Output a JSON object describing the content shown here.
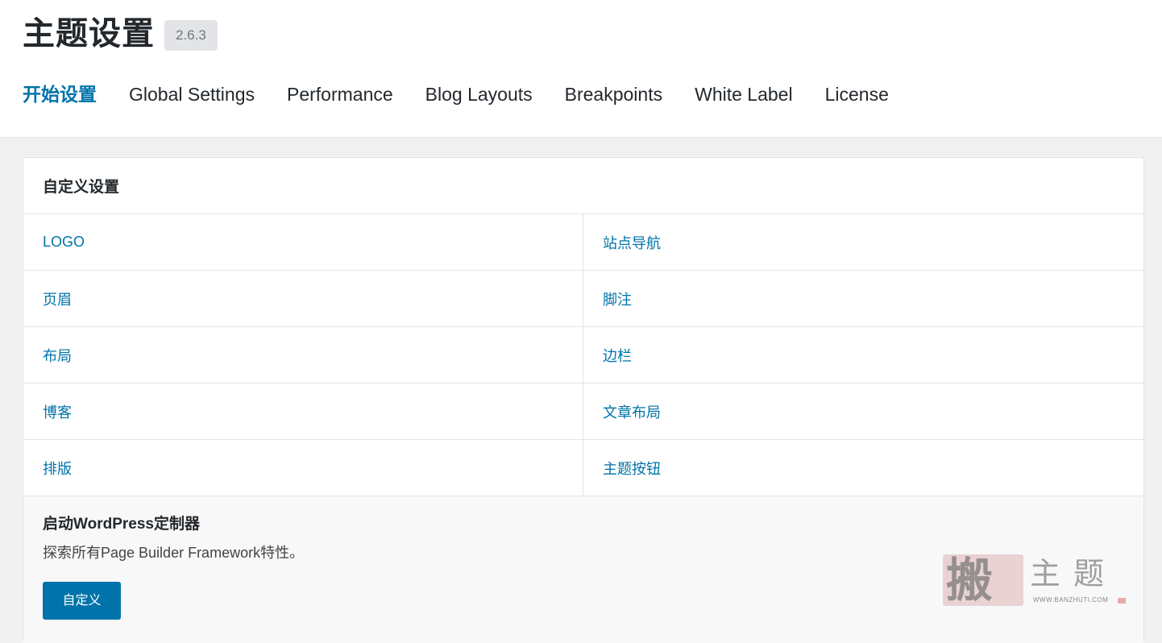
{
  "header": {
    "title": "主题设置",
    "version": "2.6.3"
  },
  "tabs": [
    {
      "label": "开始设置",
      "active": true
    },
    {
      "label": "Global Settings",
      "active": false
    },
    {
      "label": "Performance",
      "active": false
    },
    {
      "label": "Blog Layouts",
      "active": false
    },
    {
      "label": "Breakpoints",
      "active": false
    },
    {
      "label": "White Label",
      "active": false
    },
    {
      "label": "License",
      "active": false
    }
  ],
  "panel": {
    "title": "自定义设置",
    "rows": [
      {
        "left": "LOGO",
        "right": "站点导航"
      },
      {
        "left": "页眉",
        "right": "脚注"
      },
      {
        "left": "布局",
        "right": "边栏"
      },
      {
        "left": "博客",
        "right": "文章布局"
      },
      {
        "left": "排版",
        "right": "主题按钮"
      }
    ]
  },
  "footer": {
    "title": "启动WordPress定制器",
    "description": "探索所有Page Builder Framework特性。",
    "button_label": "自定义"
  },
  "watermark": {
    "seal": "搬",
    "text": "主题",
    "url": "WWW.BANZHUTI.COM"
  },
  "colors": {
    "accent": "#0073aa",
    "text": "#23282d",
    "border": "#e2e4e7",
    "background": "#f1f1f1"
  }
}
